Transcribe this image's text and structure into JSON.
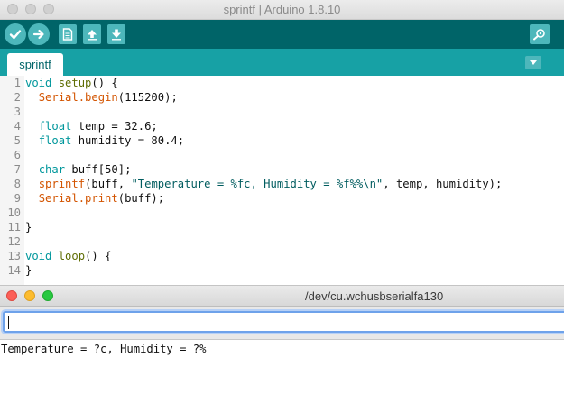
{
  "window": {
    "title": "sprintf | Arduino 1.8.10"
  },
  "toolbar": {
    "buttons": [
      {
        "name": "verify",
        "icon": "check-icon"
      },
      {
        "name": "upload",
        "icon": "arrow-right-icon"
      },
      {
        "name": "new",
        "icon": "new-file-icon"
      },
      {
        "name": "open",
        "icon": "arrow-up-icon"
      },
      {
        "name": "save",
        "icon": "arrow-down-icon"
      },
      {
        "name": "serial-monitor",
        "icon": "magnifier-icon"
      }
    ]
  },
  "tabs": [
    {
      "label": "sprintf",
      "active": true
    }
  ],
  "editor": {
    "lines": [
      {
        "num": "1",
        "text": "void setup() {"
      },
      {
        "num": "2",
        "text": "  Serial.begin(115200);"
      },
      {
        "num": "3",
        "text": ""
      },
      {
        "num": "4",
        "text": "  float temp = 32.6;"
      },
      {
        "num": "5",
        "text": "  float humidity = 80.4;"
      },
      {
        "num": "6",
        "text": ""
      },
      {
        "num": "7",
        "text": "  char buff[50];"
      },
      {
        "num": "8",
        "text": "  sprintf(buff, \"Temperature = %fc, Humidity = %f%%\\n\", temp, humidity);"
      },
      {
        "num": "9",
        "text": "  Serial.print(buff);"
      },
      {
        "num": "10",
        "text": ""
      },
      {
        "num": "11",
        "text": "}"
      },
      {
        "num": "12",
        "text": ""
      },
      {
        "num": "13",
        "text": "void loop() {"
      },
      {
        "num": "14",
        "text": "}"
      }
    ]
  },
  "serial_monitor": {
    "title": "/dev/cu.wchusbserialfa130",
    "input_value": "",
    "output_lines": [
      "Temperature = ?c, Humidity = ?%"
    ]
  },
  "colors": {
    "toolbar_bg": "#006468",
    "tabstrip_bg": "#17a1a5",
    "button_bg": "#4db7bb",
    "keyword": "#00979c",
    "function": "#d35400",
    "string": "#005c5f"
  }
}
